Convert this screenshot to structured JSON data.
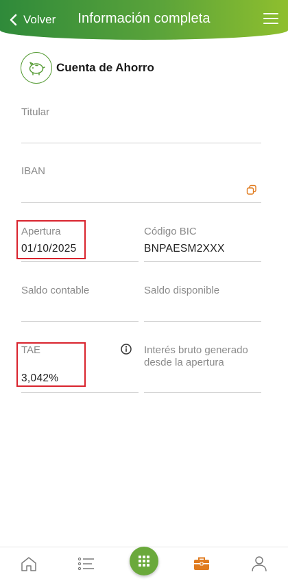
{
  "header": {
    "back_label": "Volver",
    "title": "Información completa",
    "back_icon": "chevron-left-icon",
    "menu_icon": "hamburger-menu-icon",
    "gradient_colors": [
      "#2f8a3a",
      "#8fbf2e"
    ]
  },
  "account": {
    "icon": "piggy-bank-icon",
    "title": "Cuenta de Ahorro"
  },
  "fields": {
    "titular": {
      "label": "Titular",
      "value": ""
    },
    "iban": {
      "label": "IBAN",
      "value": "",
      "action_icon": "copy-icon"
    },
    "apertura": {
      "label": "Apertura",
      "value": "01/10/2025"
    },
    "bic": {
      "label": "Código BIC",
      "value": "BNPAESM2XXX"
    },
    "saldo_contable": {
      "label": "Saldo contable",
      "value": ""
    },
    "saldo_disponible": {
      "label": "Saldo disponible",
      "value": ""
    },
    "tae": {
      "label": "TAE",
      "value": "3,042%",
      "info_icon": "info-icon"
    },
    "interes": {
      "label": "Interés bruto generado desde la apertura",
      "value": ""
    }
  },
  "highlight_color": "#d9232d",
  "bottom_nav": {
    "items": [
      {
        "icon": "home-icon",
        "active": false
      },
      {
        "icon": "list-icon",
        "active": false
      },
      {
        "icon": "grid-menu-icon",
        "active": false,
        "accent": "#6aa93b"
      },
      {
        "icon": "briefcase-icon",
        "active": true,
        "accent": "#e07b1f"
      },
      {
        "icon": "user-icon",
        "active": false
      }
    ]
  }
}
